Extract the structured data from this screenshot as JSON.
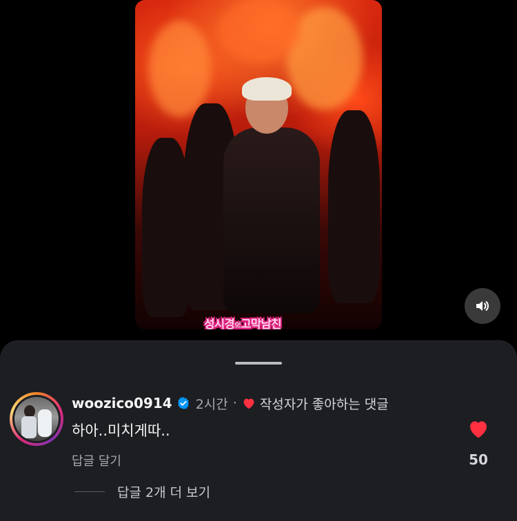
{
  "video": {
    "caption_part1": "성시경",
    "caption_small": "의",
    "caption_part2": "고막남친",
    "sound_icon": "speaker-on-icon"
  },
  "comment": {
    "username": "woozico0914",
    "verified_icon": "verified-badge-icon",
    "time": "2시간",
    "separator": "·",
    "liked_by_author_label": "작성자가 좋아하는 댓글",
    "text": "하아..미치게따..",
    "reply_label": "답글 달기",
    "like_count": "50",
    "more_replies_label": "답글 2개 더 보기"
  },
  "colors": {
    "heart": "#ff3040",
    "verified": "#0095f6",
    "sheet_bg": "#1c1e22"
  }
}
